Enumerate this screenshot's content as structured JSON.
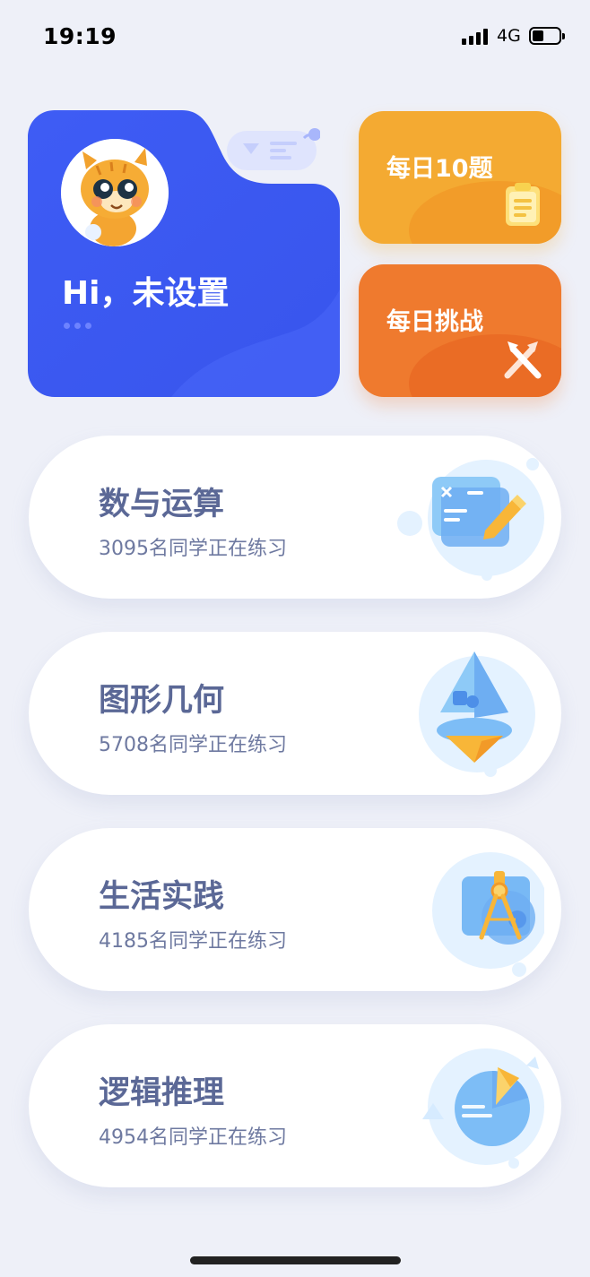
{
  "status": {
    "time": "19:19",
    "network": "4G"
  },
  "profile": {
    "greeting": "Hi，未设置",
    "avatar_icon": "tiger-avatar-icon"
  },
  "quick": {
    "daily10": {
      "label": "每日10题",
      "icon": "clipboard-icon",
      "color": "#f4aa32"
    },
    "challenge": {
      "label": "每日挑战",
      "icon": "crossed-swords-icon",
      "color": "#ef7a2e"
    }
  },
  "subjects": [
    {
      "title": "数与运算",
      "sub": "3095名同学正在练习",
      "icon": "calculator-icon"
    },
    {
      "title": "图形几何",
      "sub": "5708名同学正在练习",
      "icon": "geometry-icon"
    },
    {
      "title": "生活实践",
      "sub": "4185名同学正在练习",
      "icon": "compass-icon"
    },
    {
      "title": "逻辑推理",
      "sub": "4954名同学正在练习",
      "icon": "pie-chart-icon"
    }
  ],
  "colors": {
    "primary": "#3c5bf2",
    "background": "#eef0f8",
    "text": "#5b6896"
  }
}
